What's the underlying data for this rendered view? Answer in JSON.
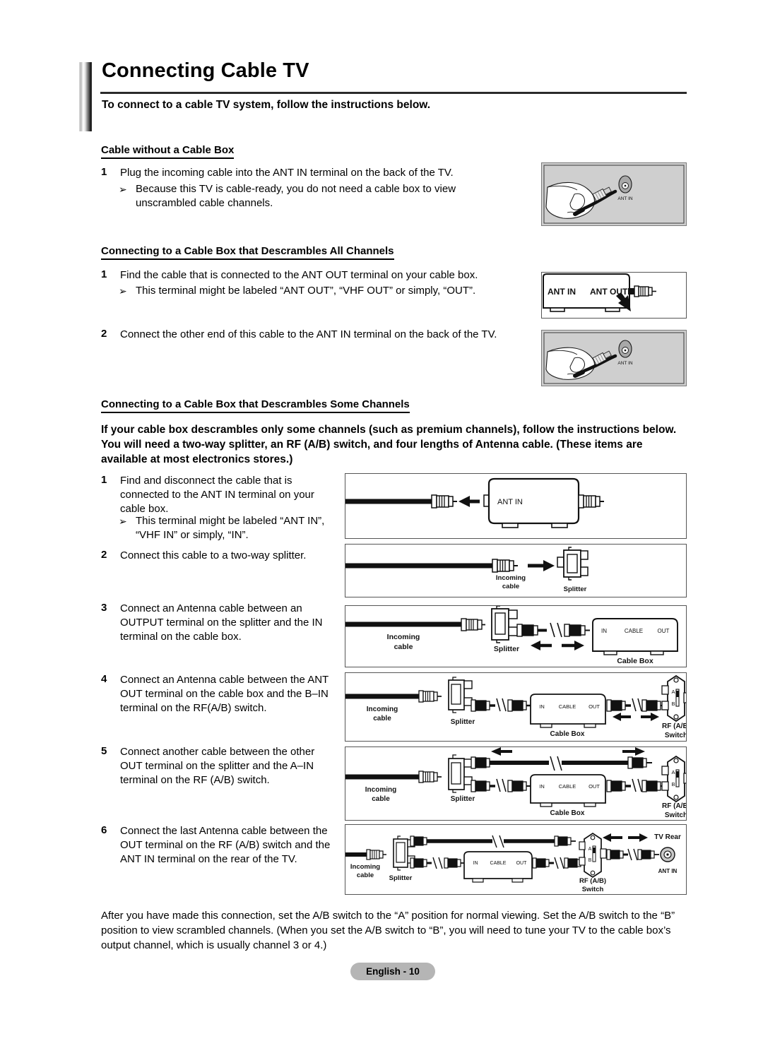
{
  "document": {
    "title": "Connecting Cable TV",
    "subtitle": "To connect to a cable TV system, follow the instructions below.",
    "footer": "English - 10"
  },
  "sections": [
    {
      "heading": "Cable without a Cable Box",
      "steps": [
        {
          "num": "1",
          "text": "Plug the incoming cable into the ANT IN terminal on the back of the TV."
        },
        {
          "num": "➢",
          "text": "Because this TV is cable-ready, you do not need a cable box to view unscrambled cable channels."
        }
      ]
    },
    {
      "heading": "Connecting to a Cable Box that Descrambles All Channels",
      "steps": [
        {
          "num": "1",
          "text": "Find the cable that is connected to the ANT OUT terminal on your cable box."
        },
        {
          "num": "➢",
          "text": "This terminal might be labeled “ANT OUT”, “VHF OUT” or simply, “OUT”."
        },
        {
          "num": "2",
          "text": "Connect the other end of this cable to the ANT IN terminal on the back of the TV."
        }
      ]
    },
    {
      "heading": "Connecting to a Cable Box that Descrambles Some Channels",
      "intro": "If your cable box descrambles only some channels (such as premium channels), follow the instructions below. You will need a two-way splitter, an RF (A/B) switch, and four lengths of Antenna cable. (These items are available at most electronics stores.)",
      "steps": [
        {
          "num": "1",
          "text": "Find and disconnect the cable that is connected to the ANT IN terminal on your cable box."
        },
        {
          "num": "➢",
          "text": "This terminal might be labeled “ANT IN”, “VHF IN” or simply, “IN”."
        },
        {
          "num": "2",
          "text": "Connect this cable to a two-way splitter."
        },
        {
          "num": "3",
          "text": "Connect an Antenna cable between an OUTPUT terminal on the splitter and the IN terminal on the cable box."
        },
        {
          "num": "4",
          "text": "Connect an Antenna cable between the ANT OUT terminal on the cable box and the B–IN terminal on the RF(A/B) switch."
        },
        {
          "num": "5",
          "text": "Connect another cable between the other OUT terminal on the splitter and the A–IN terminal on the RF (A/B) switch."
        },
        {
          "num": "6",
          "text": "Connect the last Antenna cable between the OUT terminal on the RF (A/B) switch and the ANT IN terminal on the rear of the TV."
        }
      ]
    }
  ],
  "closing": "After you have made this connection, set the A/B switch to the “A” position for normal viewing. Set the A/B switch to the “B” position to view scrambled channels. (When you set the A/B switch to “B”, you will need to tune your TV to the cable box’s output channel, which is usually channel 3 or 4.)",
  "figures": {
    "photo_hand_top": {
      "label": "ANT IN"
    },
    "cablebox_antout": {
      "label_in": "ANT IN",
      "label_out": "ANT OUT"
    },
    "photo_hand_bottom": {
      "label": "ANT IN"
    },
    "step1": {
      "box_label": "ANT IN"
    },
    "step2": {
      "cable_label_1": "Incoming",
      "cable_label_2": "cable",
      "splitter": "Splitter"
    },
    "step3": {
      "cable_label_1": "Incoming",
      "cable_label_2": "cable",
      "splitter": "Splitter",
      "box_in": "IN",
      "box_cable": "CABLE",
      "box_out": "OUT",
      "cablebox": "Cable Box"
    },
    "step4": {
      "cable_label_1": "Incoming",
      "cable_label_2": "cable",
      "splitter": "Splitter",
      "box_in": "IN",
      "box_cable": "CABLE",
      "box_out": "OUT",
      "cablebox": "Cable Box",
      "switch_a": "A",
      "switch_b": "B",
      "switch_1": "RF (A/B)",
      "switch_2": "Switch"
    },
    "step5": {
      "cable_label_1": "Incoming",
      "cable_label_2": "cable",
      "splitter": "Splitter",
      "box_in": "IN",
      "box_cable": "CABLE",
      "box_out": "OUT",
      "cablebox": "Cable Box",
      "switch_a": "A",
      "switch_b": "B",
      "switch_1": "RF (A/B)",
      "switch_2": "Switch"
    },
    "step6": {
      "cable_label_1": "Incoming",
      "cable_label_2": "cable",
      "splitter": "Splitter",
      "box_in": "IN",
      "box_cable": "CABLE",
      "box_out": "OUT",
      "switch_a": "A",
      "switch_b": "B",
      "switch_1": "RF (A/B)",
      "switch_2": "Switch",
      "tv_rear": "TV Rear",
      "tv_antin": "ANT IN"
    }
  }
}
